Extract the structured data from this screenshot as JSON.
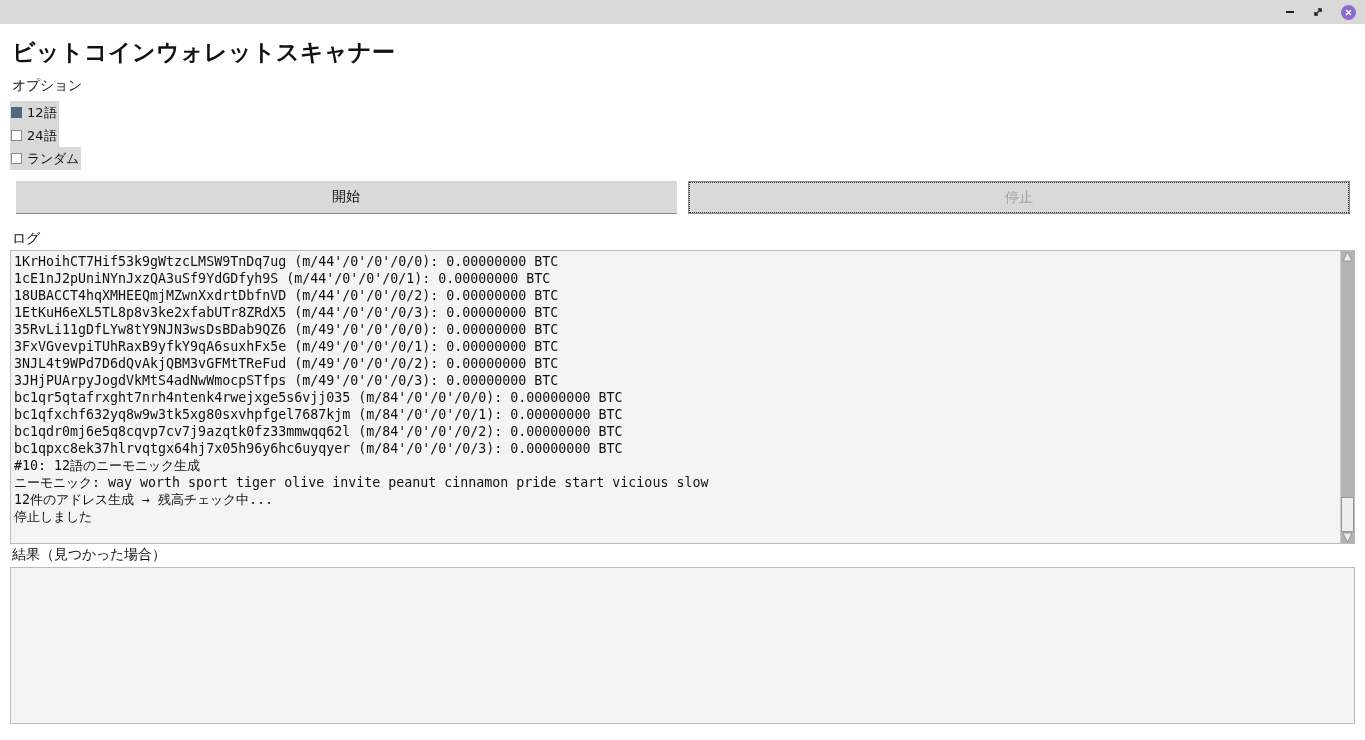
{
  "window": {
    "title": "ビットコインウォレットスキャナー"
  },
  "options": {
    "label": "オプション",
    "items": [
      {
        "label": "12語",
        "checked": true
      },
      {
        "label": "24語",
        "checked": false
      },
      {
        "label": "ランダム",
        "checked": false
      }
    ]
  },
  "buttons": [
    {
      "label": "開始",
      "disabled": false
    },
    {
      "label": "停止",
      "disabled": true
    }
  ],
  "log": {
    "label": "ログ",
    "lines": [
      "1KrHoihCT7Hif53k9gWtzcLMSW9TnDq7ug (m/44'/0'/0'/0/0): 0.00000000 BTC",
      "1cE1nJ2pUniNYnJxzQA3uSf9YdGDfyh9S (m/44'/0'/0'/0/1): 0.00000000 BTC",
      "18UBACCT4hqXMHEEQmjMZwnXxdrtDbfnVD (m/44'/0'/0'/0/2): 0.00000000 BTC",
      "1EtKuH6eXL5TL8p8v3ke2xfabUTr8ZRdX5 (m/44'/0'/0'/0/3): 0.00000000 BTC",
      "35RvLi11gDfLYw8tY9NJN3wsDsBDab9QZ6 (m/49'/0'/0'/0/0): 0.00000000 BTC",
      "3FxVGvevpiTUhRaxB9yfkY9qA6suxhFx5e (m/49'/0'/0'/0/1): 0.00000000 BTC",
      "3NJL4t9WPd7D6dQvAkjQBM3vGFMtTReFud (m/49'/0'/0'/0/2): 0.00000000 BTC",
      "3JHjPUArpyJogdVkMtS4adNwWmocpSTfps (m/49'/0'/0'/0/3): 0.00000000 BTC",
      "bc1qr5qtafrxght7nrh4ntenk4rwejxge5s6vjj035 (m/84'/0'/0'/0/0): 0.00000000 BTC",
      "bc1qfxchf632yq8w9w3tk5xg80sxvhpfgel7687kjm (m/84'/0'/0'/0/1): 0.00000000 BTC",
      "bc1qdr0mj6e5q8cqvp7cv7j9azqtk0fz33mmwqq62l (m/84'/0'/0'/0/2): 0.00000000 BTC",
      "bc1qpxc8ek37hlrvqtgx64hj7x05h96y6hc6uyqyer (m/84'/0'/0'/0/3): 0.00000000 BTC",
      "#10: 12語のニーモニック生成",
      "ニーモニック: way worth sport tiger olive invite peanut cinnamon pride start vicious slow",
      "12件のアドレス生成 → 残高チェック中...",
      "停止しました"
    ]
  },
  "results": {
    "label": "結果（見つかった場合）"
  }
}
